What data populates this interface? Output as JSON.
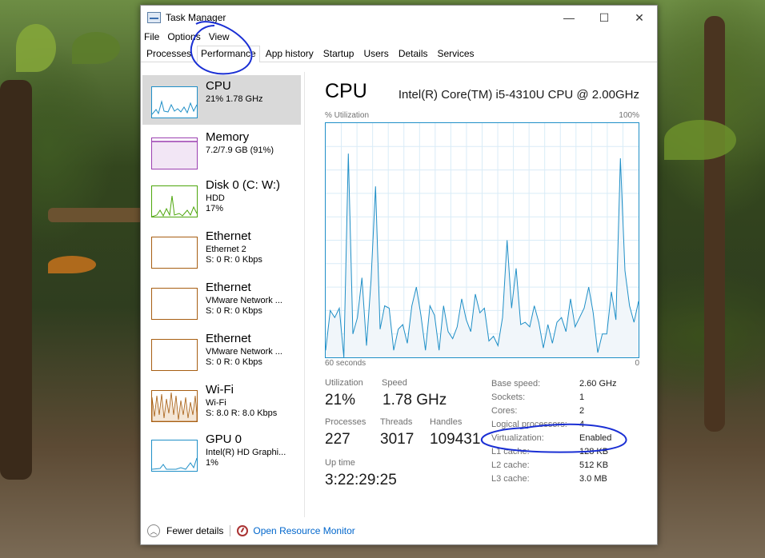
{
  "window": {
    "title": "Task Manager",
    "controls": {
      "minimize": "—",
      "maximize": "☐",
      "close": "✕"
    }
  },
  "menu": [
    "File",
    "Options",
    "View"
  ],
  "tabs": [
    {
      "label": "Processes",
      "active": false
    },
    {
      "label": "Performance",
      "active": true
    },
    {
      "label": "App history",
      "active": false
    },
    {
      "label": "Startup",
      "active": false
    },
    {
      "label": "Users",
      "active": false
    },
    {
      "label": "Details",
      "active": false
    },
    {
      "label": "Services",
      "active": false
    }
  ],
  "sidebar": [
    {
      "title": "CPU",
      "lines": [
        "21% 1.78 GHz"
      ],
      "color": "#1f8fc7",
      "selected": true
    },
    {
      "title": "Memory",
      "lines": [
        "7.2/7.9 GB (91%)"
      ],
      "color": "#9b3fb0",
      "selected": false
    },
    {
      "title": "Disk 0 (C: W:)",
      "lines": [
        "HDD",
        "17%"
      ],
      "color": "#4da60c",
      "selected": false
    },
    {
      "title": "Ethernet",
      "lines": [
        "Ethernet 2",
        "S: 0 R: 0 Kbps"
      ],
      "color": "#a75e12",
      "selected": false
    },
    {
      "title": "Ethernet",
      "lines": [
        "VMware Network ...",
        "S: 0 R: 0 Kbps"
      ],
      "color": "#a75e12",
      "selected": false
    },
    {
      "title": "Ethernet",
      "lines": [
        "VMware Network ...",
        "S: 0 R: 0 Kbps"
      ],
      "color": "#a75e12",
      "selected": false
    },
    {
      "title": "Wi-Fi",
      "lines": [
        "Wi-Fi",
        "S: 8.0 R: 8.0 Kbps"
      ],
      "color": "#a75e12",
      "selected": false
    },
    {
      "title": "GPU 0",
      "lines": [
        "Intel(R) HD Graphi...",
        "1%"
      ],
      "color": "#1f8fc7",
      "selected": false
    }
  ],
  "cpu": {
    "title": "CPU",
    "model": "Intel(R) Core(TM) i5-4310U CPU @ 2.00GHz",
    "utilization_label": "% Utilization",
    "max_label": "100%",
    "time_label": "60 seconds",
    "min_label": "0",
    "history": [
      3,
      20,
      17,
      21,
      0,
      87,
      10,
      17,
      34,
      5,
      33,
      73,
      12,
      22,
      21,
      3,
      12,
      14,
      6,
      22,
      30,
      18,
      3,
      22,
      18,
      3,
      22,
      11,
      8,
      13,
      25,
      16,
      11,
      27,
      19,
      21,
      7,
      9,
      5,
      17,
      50,
      21,
      38,
      14,
      15,
      13,
      22,
      15,
      4,
      14,
      6,
      15,
      17,
      11,
      25,
      13,
      17,
      21,
      30,
      19,
      2,
      10,
      10,
      28,
      16,
      85,
      37,
      22,
      15,
      24
    ],
    "stats": {
      "utilization": {
        "label": "Utilization",
        "value": "21%"
      },
      "speed": {
        "label": "Speed",
        "value": "1.78 GHz"
      },
      "processes": {
        "label": "Processes",
        "value": "227"
      },
      "threads": {
        "label": "Threads",
        "value": "3017"
      },
      "handles": {
        "label": "Handles",
        "value": "109431"
      },
      "uptime": {
        "label": "Up time",
        "value": "3:22:29:25"
      }
    },
    "details": [
      {
        "label": "Base speed:",
        "value": "2.60 GHz"
      },
      {
        "label": "Sockets:",
        "value": "1"
      },
      {
        "label": "Cores:",
        "value": "2"
      },
      {
        "label": "Logical processors:",
        "value": "4"
      },
      {
        "label": "Virtualization:",
        "value": "Enabled"
      },
      {
        "label": "L1 cache:",
        "value": "128 KB"
      },
      {
        "label": "L2 cache:",
        "value": "512 KB"
      },
      {
        "label": "L3 cache:",
        "value": "3.0 MB"
      }
    ]
  },
  "footer": {
    "fewer_details": "Fewer details",
    "resource_monitor": "Open Resource Monitor"
  },
  "colors": {
    "accent": "#1f8fc7",
    "graph_fill": "#f1f6fa",
    "selected": "#d9d9d9",
    "link": "#0066cc",
    "annotation": "#1a2fd4"
  }
}
